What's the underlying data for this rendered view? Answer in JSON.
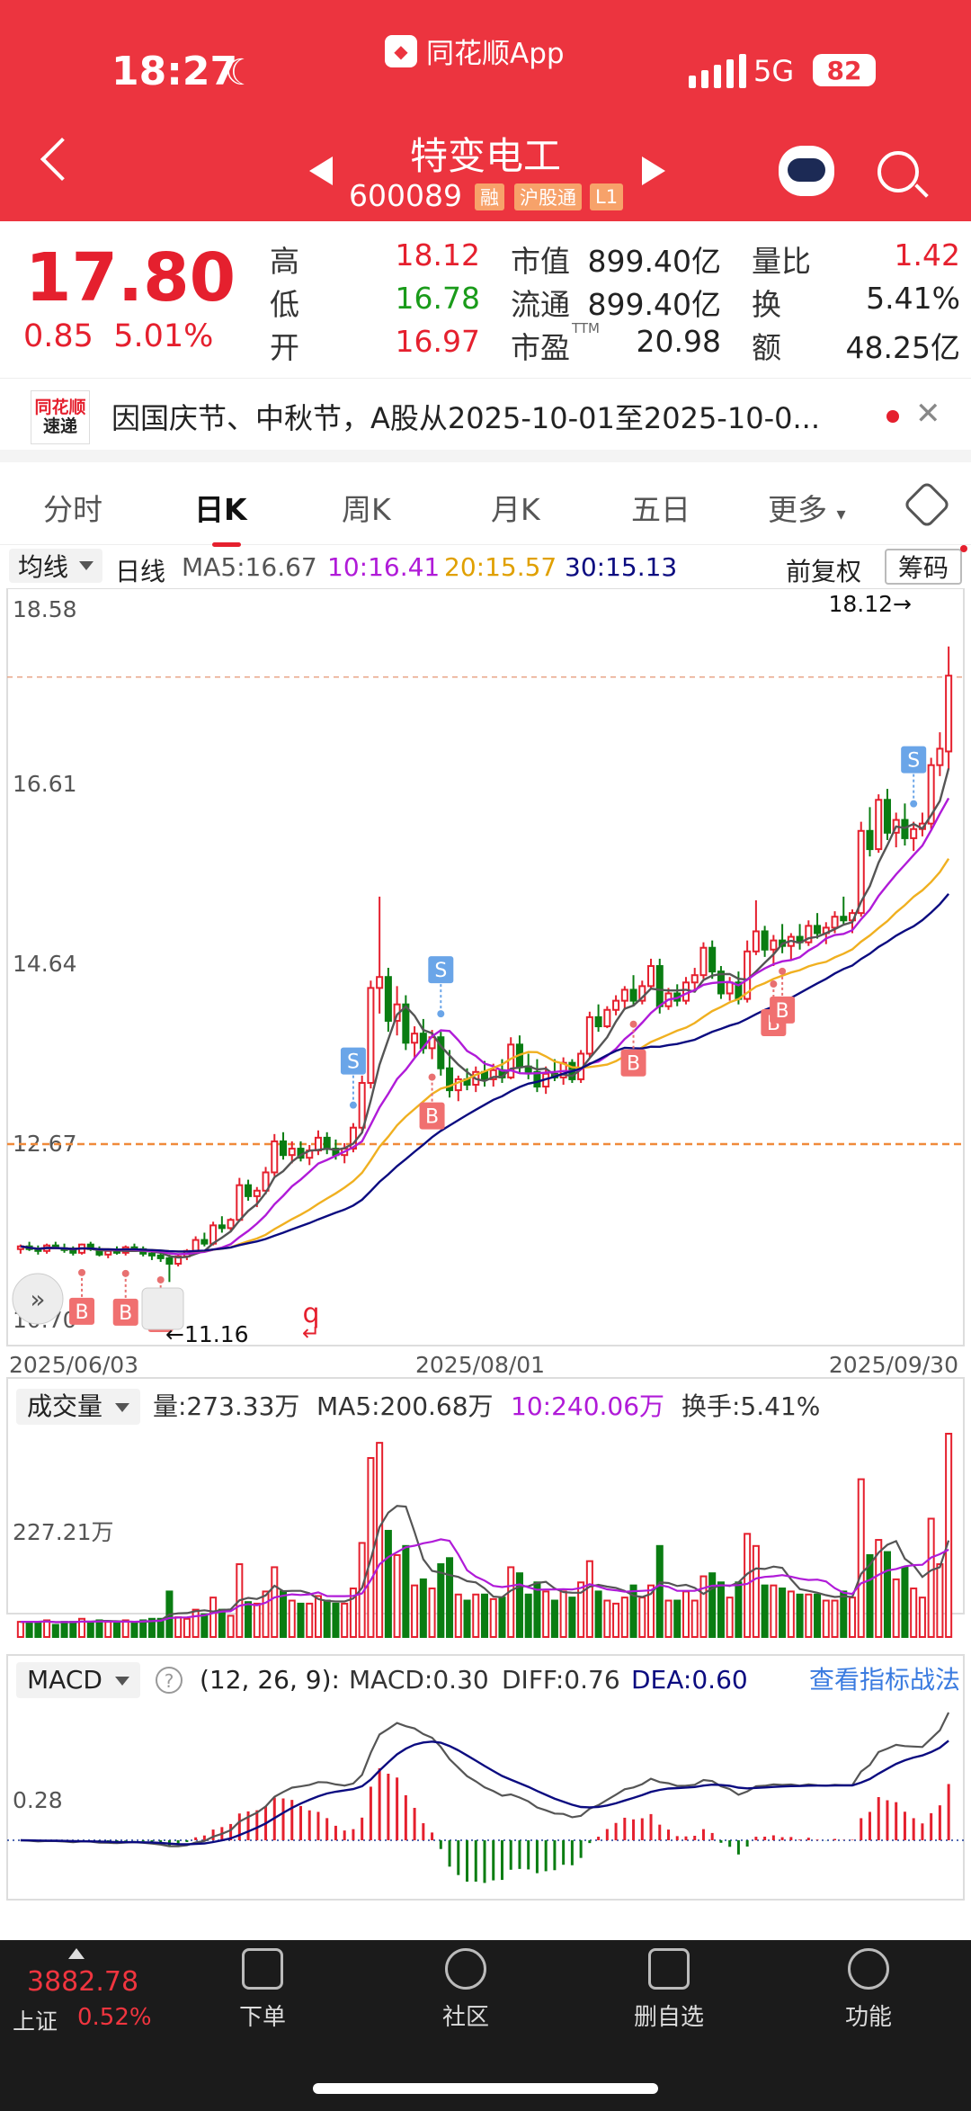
{
  "status_bar": {
    "time": "18:27",
    "app_name": "同花顺App",
    "network": "5G",
    "battery": "82"
  },
  "header": {
    "title": "特变电工",
    "code": "600089",
    "tags": [
      "融",
      "沪股通",
      "L1"
    ]
  },
  "quote": {
    "price": "17.80",
    "change": "0.85",
    "change_pct": "5.01%",
    "rows": [
      {
        "l1": "高",
        "v1": "18.12",
        "l2": "市值",
        "v2": "899.40亿",
        "l3": "量比",
        "v3": "1.42"
      },
      {
        "l1": "低",
        "v1": "16.78",
        "l2": "流通",
        "v2": "899.40亿",
        "l3": "换",
        "v3": "5.41%"
      },
      {
        "l1": "开",
        "v1": "16.97",
        "l2": "市盈",
        "v2": "20.98",
        "l3": "额",
        "v3": "48.25亿"
      }
    ],
    "ttm": "TTM"
  },
  "news": {
    "logo_top": "同花顺",
    "logo_bottom": "速递",
    "text": "因国庆节、中秋节，A股从2025-10-01至2025-10-0..."
  },
  "tabs": [
    "分时",
    "日K",
    "周K",
    "月K",
    "五日",
    "更多"
  ],
  "active_tab": "日K",
  "kline_bar": {
    "selector": "均线",
    "period": "日线",
    "ma5": "MA5:16.67",
    "ma10": "10:16.41",
    "ma20": "20:15.57",
    "ma30": "30:15.13",
    "adjust": "前复权",
    "chip": "筹码"
  },
  "colors": {
    "up": "#e5202e",
    "down": "#0a7d12",
    "ma5": "#555555",
    "ma10": "#b01bd8",
    "ma20": "#f0b020",
    "ma30": "#0b0b80"
  },
  "chart_data": [
    {
      "type": "candlestick",
      "y_ticks": [
        "18.58",
        "16.61",
        "14.64",
        "12.67",
        "10.70"
      ],
      "ylim": [
        10.7,
        18.58
      ],
      "x_ticks": [
        "2025/06/03",
        "2025/08/01",
        "2025/09/30"
      ],
      "annotations": {
        "high": "18.12→",
        "low": "←11.16",
        "ref_line": 12.67
      },
      "signals": [
        {
          "label": "B",
          "i": 7
        },
        {
          "label": "B",
          "i": 12
        },
        {
          "label": "B",
          "i": 16
        },
        {
          "label": "S",
          "i": 38
        },
        {
          "label": "B",
          "i": 47
        },
        {
          "label": "S",
          "i": 48
        },
        {
          "label": "B",
          "i": 70
        },
        {
          "label": "B",
          "i": 86
        },
        {
          "label": "B",
          "i": 87
        },
        {
          "label": "S",
          "i": 102
        }
      ],
      "ohlc": [
        [
          11.52,
          11.57,
          11.47,
          11.55
        ],
        [
          11.55,
          11.6,
          11.5,
          11.52
        ],
        [
          11.52,
          11.56,
          11.46,
          11.5
        ],
        [
          11.5,
          11.58,
          11.47,
          11.56
        ],
        [
          11.56,
          11.6,
          11.52,
          11.53
        ],
        [
          11.53,
          11.58,
          11.48,
          11.51
        ],
        [
          11.51,
          11.55,
          11.45,
          11.48
        ],
        [
          11.48,
          11.58,
          11.46,
          11.57
        ],
        [
          11.57,
          11.6,
          11.5,
          11.52
        ],
        [
          11.52,
          11.55,
          11.44,
          11.46
        ],
        [
          11.46,
          11.52,
          11.42,
          11.5
        ],
        [
          11.5,
          11.55,
          11.46,
          11.48
        ],
        [
          11.48,
          11.56,
          11.45,
          11.54
        ],
        [
          11.54,
          11.58,
          11.49,
          11.52
        ],
        [
          11.52,
          11.55,
          11.44,
          11.47
        ],
        [
          11.47,
          11.52,
          11.4,
          11.45
        ],
        [
          11.45,
          11.5,
          11.38,
          11.42
        ],
        [
          11.42,
          11.46,
          11.16,
          11.36
        ],
        [
          11.36,
          11.46,
          11.33,
          11.44
        ],
        [
          11.44,
          11.52,
          11.4,
          11.5
        ],
        [
          11.5,
          11.66,
          11.48,
          11.62
        ],
        [
          11.62,
          11.7,
          11.55,
          11.58
        ],
        [
          11.58,
          11.82,
          11.56,
          11.78
        ],
        [
          11.78,
          11.88,
          11.7,
          11.75
        ],
        [
          11.75,
          11.86,
          11.72,
          11.84
        ],
        [
          11.84,
          12.3,
          11.82,
          12.22
        ],
        [
          12.22,
          12.28,
          12.05,
          12.1
        ],
        [
          12.1,
          12.2,
          11.98,
          12.16
        ],
        [
          12.16,
          12.42,
          12.12,
          12.36
        ],
        [
          12.36,
          12.78,
          12.32,
          12.7
        ],
        [
          12.7,
          12.8,
          12.5,
          12.55
        ],
        [
          12.55,
          12.7,
          12.46,
          12.62
        ],
        [
          12.62,
          12.7,
          12.48,
          12.52
        ],
        [
          12.52,
          12.66,
          12.44,
          12.6
        ],
        [
          12.6,
          12.82,
          12.55,
          12.74
        ],
        [
          12.74,
          12.8,
          12.56,
          12.62
        ],
        [
          12.62,
          12.72,
          12.5,
          12.55
        ],
        [
          12.55,
          12.68,
          12.46,
          12.62
        ],
        [
          12.62,
          12.9,
          12.58,
          12.85
        ],
        [
          12.85,
          13.42,
          12.8,
          13.34
        ],
        [
          13.34,
          14.46,
          13.28,
          14.38
        ],
        [
          14.38,
          15.38,
          14.1,
          14.5
        ],
        [
          14.5,
          14.6,
          13.9,
          14.02
        ],
        [
          14.02,
          14.4,
          13.86,
          14.2
        ],
        [
          14.2,
          14.3,
          13.7,
          13.78
        ],
        [
          13.78,
          13.96,
          13.62,
          13.88
        ],
        [
          13.88,
          14.04,
          13.66,
          13.72
        ],
        [
          13.72,
          13.92,
          13.6,
          13.84
        ],
        [
          13.84,
          13.9,
          13.42,
          13.5
        ],
        [
          13.5,
          13.7,
          13.18,
          13.26
        ],
        [
          13.26,
          13.42,
          13.14,
          13.38
        ],
        [
          13.38,
          13.5,
          13.26,
          13.32
        ],
        [
          13.32,
          13.52,
          13.24,
          13.46
        ],
        [
          13.46,
          13.58,
          13.3,
          13.38
        ],
        [
          13.38,
          13.55,
          13.3,
          13.48
        ],
        [
          13.48,
          13.6,
          13.34,
          13.4
        ],
        [
          13.4,
          13.84,
          13.38,
          13.76
        ],
        [
          13.76,
          13.86,
          13.44,
          13.52
        ],
        [
          13.52,
          13.66,
          13.38,
          13.46
        ],
        [
          13.46,
          13.6,
          13.24,
          13.3
        ],
        [
          13.3,
          13.52,
          13.22,
          13.44
        ],
        [
          13.44,
          13.6,
          13.36,
          13.4
        ],
        [
          13.4,
          13.62,
          13.32,
          13.56
        ],
        [
          13.56,
          13.6,
          13.34,
          13.38
        ],
        [
          13.38,
          13.7,
          13.34,
          13.66
        ],
        [
          13.66,
          14.12,
          13.62,
          14.06
        ],
        [
          14.06,
          14.2,
          13.9,
          13.96
        ],
        [
          13.96,
          14.18,
          13.94,
          14.14
        ],
        [
          14.14,
          14.3,
          14.08,
          14.24
        ],
        [
          14.24,
          14.4,
          14.14,
          14.36
        ],
        [
          14.36,
          14.52,
          14.18,
          14.24
        ],
        [
          14.24,
          14.46,
          14.2,
          14.4
        ],
        [
          14.4,
          14.7,
          14.36,
          14.62
        ],
        [
          14.62,
          14.7,
          14.1,
          14.18
        ],
        [
          14.18,
          14.38,
          14.14,
          14.32
        ],
        [
          14.32,
          14.42,
          14.18,
          14.24
        ],
        [
          14.24,
          14.5,
          14.2,
          14.44
        ],
        [
          14.44,
          14.6,
          14.36,
          14.52
        ],
        [
          14.52,
          14.88,
          14.48,
          14.82
        ],
        [
          14.82,
          14.9,
          14.48,
          14.56
        ],
        [
          14.56,
          14.62,
          14.26,
          14.32
        ],
        [
          14.32,
          14.5,
          14.24,
          14.44
        ],
        [
          14.44,
          14.56,
          14.2,
          14.26
        ],
        [
          14.26,
          14.9,
          14.22,
          14.78
        ],
        [
          14.78,
          15.34,
          14.74,
          15.0
        ],
        [
          15.0,
          15.06,
          14.72,
          14.8
        ],
        [
          14.8,
          14.96,
          14.62,
          14.9
        ],
        [
          14.9,
          15.08,
          14.76,
          14.84
        ],
        [
          14.84,
          14.98,
          14.68,
          14.94
        ],
        [
          14.94,
          15.08,
          14.8,
          14.88
        ],
        [
          14.88,
          15.12,
          14.84,
          15.06
        ],
        [
          15.06,
          15.2,
          14.92,
          14.98
        ],
        [
          14.98,
          15.1,
          14.86,
          15.04
        ],
        [
          15.04,
          15.22,
          14.98,
          15.16
        ],
        [
          15.16,
          15.38,
          15.08,
          15.12
        ],
        [
          15.12,
          15.24,
          14.98,
          15.2
        ],
        [
          15.2,
          16.2,
          15.16,
          16.1
        ],
        [
          16.1,
          16.36,
          15.82,
          15.9
        ],
        [
          15.9,
          16.5,
          15.86,
          16.44
        ],
        [
          16.44,
          16.56,
          16.0,
          16.08
        ],
        [
          16.08,
          16.3,
          15.92,
          16.22
        ],
        [
          16.22,
          16.4,
          15.94,
          16.02
        ],
        [
          16.02,
          16.2,
          15.88,
          16.12
        ],
        [
          16.12,
          16.3,
          16.04,
          16.18
        ],
        [
          16.18,
          16.9,
          16.12,
          16.82
        ],
        [
          16.82,
          17.18,
          16.7,
          17.0
        ],
        [
          16.97,
          18.12,
          16.78,
          17.8
        ]
      ]
    },
    {
      "type": "bar",
      "title": "成交量",
      "labels": {
        "vol": "量:273.33万",
        "ma5": "MA5:200.68万",
        "ma10": "10:240.06万",
        "turnover": "换手:5.41%"
      },
      "y_ticks": [
        "227.21万"
      ]
    },
    {
      "type": "bar",
      "title": "MACD",
      "labels": {
        "params": "(12, 26, 9):",
        "macd": "MACD:0.30",
        "diff": "DIFF:0.76",
        "dea": "DEA:0.60",
        "link": "查看指标战法"
      },
      "y_ticks": [
        "0.28"
      ]
    }
  ],
  "bottom_nav": {
    "index_value": "3882.78",
    "index_name": "上证",
    "index_pct": "0.52%",
    "items": [
      "下单",
      "社区",
      "删自选",
      "功能"
    ]
  }
}
